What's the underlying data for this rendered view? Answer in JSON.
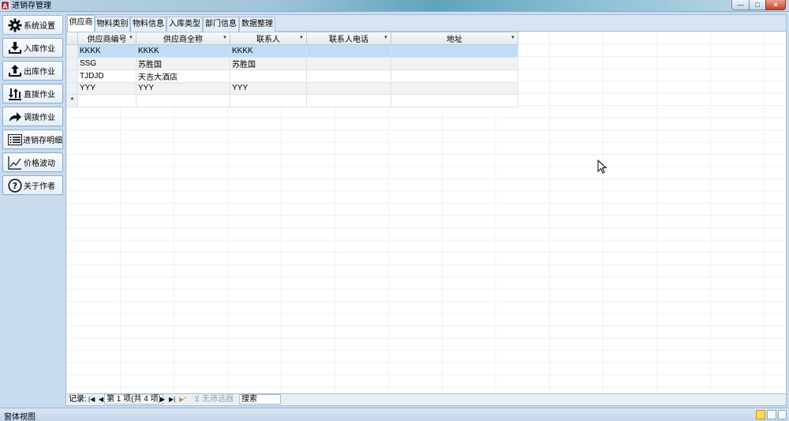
{
  "window": {
    "title": "进销存管理",
    "app_icon_letter": "A"
  },
  "nav": {
    "items": [
      {
        "label": "系统设置",
        "icon": "gear-icon",
        "active": true
      },
      {
        "label": "入库作业",
        "icon": "download-icon"
      },
      {
        "label": "出库作业",
        "icon": "upload-icon"
      },
      {
        "label": "直拨作业",
        "icon": "transfer-arrows-icon"
      },
      {
        "label": "调拨作业",
        "icon": "redo-arrow-icon"
      },
      {
        "label": "进销存明细",
        "icon": "list-icon"
      },
      {
        "label": "价格波动",
        "icon": "line-chart-icon"
      },
      {
        "label": "关于作者",
        "icon": "help-icon"
      }
    ]
  },
  "tabs": [
    "供应商",
    "物料类别",
    "物料信息",
    "入库类型",
    "部门信息",
    "数据整理"
  ],
  "grid": {
    "columns": [
      "供应商编号",
      "供应商全称",
      "联系人",
      "联系人电话",
      "地址"
    ],
    "rows": [
      [
        "KKKK",
        "KKKK",
        "KKKK",
        "",
        ""
      ],
      [
        "SSG",
        "苏胜国",
        "苏胜国",
        "",
        ""
      ],
      [
        "TJDJD",
        "天吉大酒店",
        "",
        "",
        ""
      ],
      [
        "YYY",
        "YYY",
        "YYY",
        "",
        ""
      ]
    ],
    "new_row_marker": "*"
  },
  "record_nav": {
    "label": "记录:",
    "position": "第 1 项(共 4 项)",
    "filter_label": "无筛选器",
    "search_label": "搜索"
  },
  "status": {
    "text": "窗体视图"
  }
}
